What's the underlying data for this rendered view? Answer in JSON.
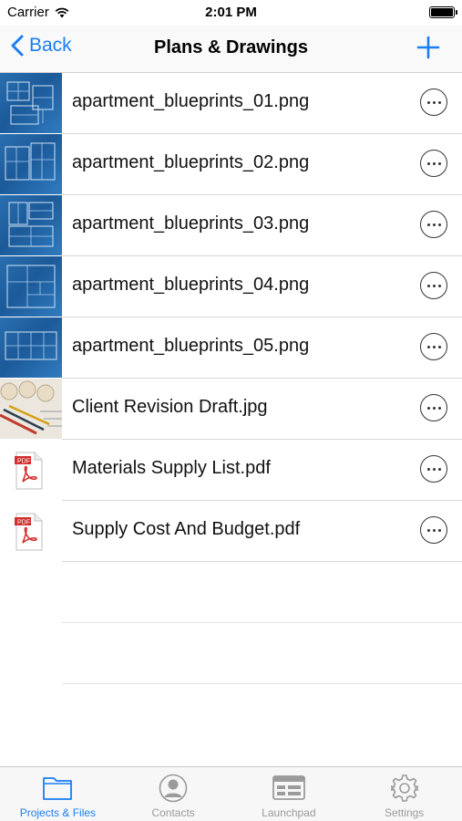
{
  "status_bar": {
    "carrier": "Carrier",
    "time": "2:01 PM"
  },
  "nav": {
    "back_label": "Back",
    "title": "Plans & Drawings"
  },
  "files": [
    {
      "name": "apartment_blueprints_01.png",
      "thumb": "blueprint"
    },
    {
      "name": "apartment_blueprints_02.png",
      "thumb": "blueprint"
    },
    {
      "name": "apartment_blueprints_03.png",
      "thumb": "blueprint"
    },
    {
      "name": "apartment_blueprints_04.png",
      "thumb": "blueprint"
    },
    {
      "name": "apartment_blueprints_05.png",
      "thumb": "blueprint"
    },
    {
      "name": "Client Revision Draft.jpg",
      "thumb": "photo"
    },
    {
      "name": "Materials Supply List.pdf",
      "thumb": "pdf"
    },
    {
      "name": "Supply Cost And Budget.pdf",
      "thumb": "pdf"
    }
  ],
  "pdf_badge": "PDF",
  "tabs": [
    {
      "label": "Projects & Files",
      "icon": "folder-icon",
      "active": true
    },
    {
      "label": "Contacts",
      "icon": "person-icon",
      "active": false
    },
    {
      "label": "Launchpad",
      "icon": "launchpad-icon",
      "active": false
    },
    {
      "label": "Settings",
      "icon": "gear-icon",
      "active": false
    }
  ],
  "colors": {
    "accent": "#1a7ef5",
    "inactive": "#9b9b9b",
    "blueprint": "#2a6fb0"
  }
}
